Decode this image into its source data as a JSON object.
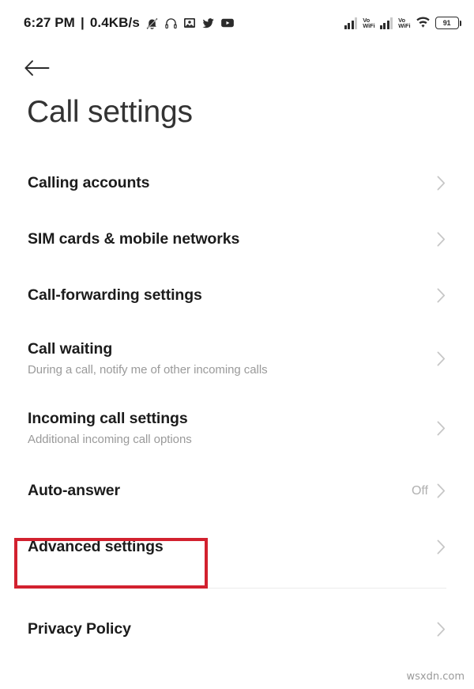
{
  "statusbar": {
    "time": "6:27 PM",
    "separator": "|",
    "network_speed": "0.4KB/s",
    "left_icons": [
      "bell-muted-icon",
      "headphones-icon",
      "screenshot-icon",
      "twitter-icon",
      "youtube-icon"
    ],
    "sim1": {
      "signal_label": "Vo",
      "signal_label2": "WiFi"
    },
    "sim2": {
      "signal_label": "Vo",
      "signal_label2": "WiFi"
    },
    "wifi": "wifi-icon",
    "battery_percent": "91"
  },
  "header": {
    "back_icon": "back-arrow-icon",
    "title": "Call settings"
  },
  "list": {
    "items": [
      {
        "title": "Calling accounts",
        "subtitle": "",
        "value": ""
      },
      {
        "title": "SIM cards & mobile networks",
        "subtitle": "",
        "value": ""
      },
      {
        "title": "Call-forwarding settings",
        "subtitle": "",
        "value": ""
      },
      {
        "title": "Call waiting",
        "subtitle": "During a call, notify me of other incoming calls",
        "value": ""
      },
      {
        "title": "Incoming call settings",
        "subtitle": "Additional incoming call options",
        "value": ""
      },
      {
        "title": "Auto-answer",
        "subtitle": "",
        "value": "Off"
      },
      {
        "title": "Advanced settings",
        "subtitle": "",
        "value": ""
      }
    ],
    "footer_items": [
      {
        "title": "Privacy Policy",
        "subtitle": "",
        "value": ""
      }
    ]
  },
  "annotation": {
    "target": "Advanced settings",
    "color": "#d2212f"
  },
  "watermark": "wsxdn.com"
}
